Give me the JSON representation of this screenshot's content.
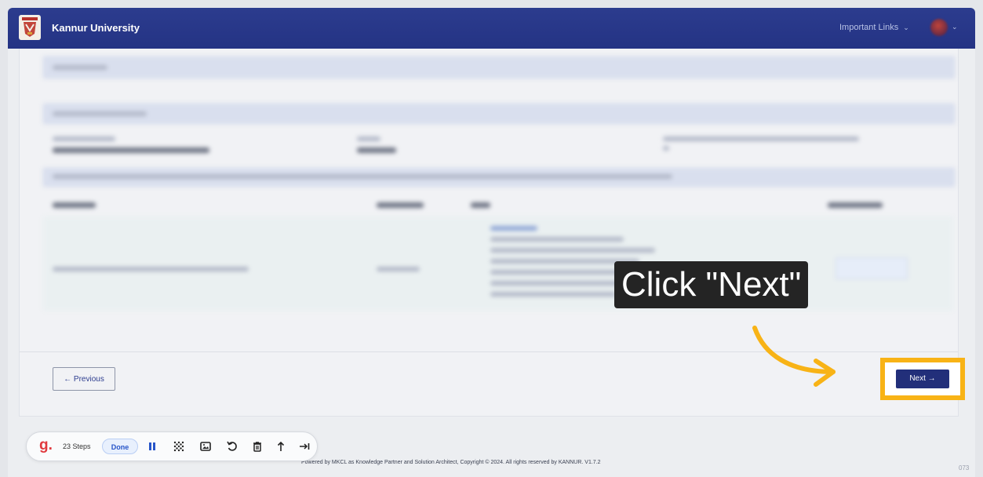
{
  "header": {
    "brand": "Kannur University",
    "important_links": "Important Links",
    "chevron": "⌄"
  },
  "form": {
    "previous_label": "← Previous",
    "next_label": "Next →"
  },
  "overlay": {
    "instruction": "Click \"Next\""
  },
  "footer": {
    "text": "Powered by MKCL as Knowledge Partner and Solution Architect, Copyright © 2024. All rights reserved by KANNUR. V1.7.2",
    "version": "073"
  },
  "recorder": {
    "logo": "g.",
    "steps": "23 Steps",
    "done_label": "Done",
    "icons": [
      "pause-icon",
      "blur-icon",
      "image-icon",
      "undo-icon",
      "trash-icon",
      "upload-icon",
      "skip-icon"
    ]
  },
  "colors": {
    "header": "#243384",
    "next_button": "#222f7a",
    "highlight": "#f8b316",
    "recorder_accent": "#e0393e",
    "done_accent": "#2755c9"
  }
}
